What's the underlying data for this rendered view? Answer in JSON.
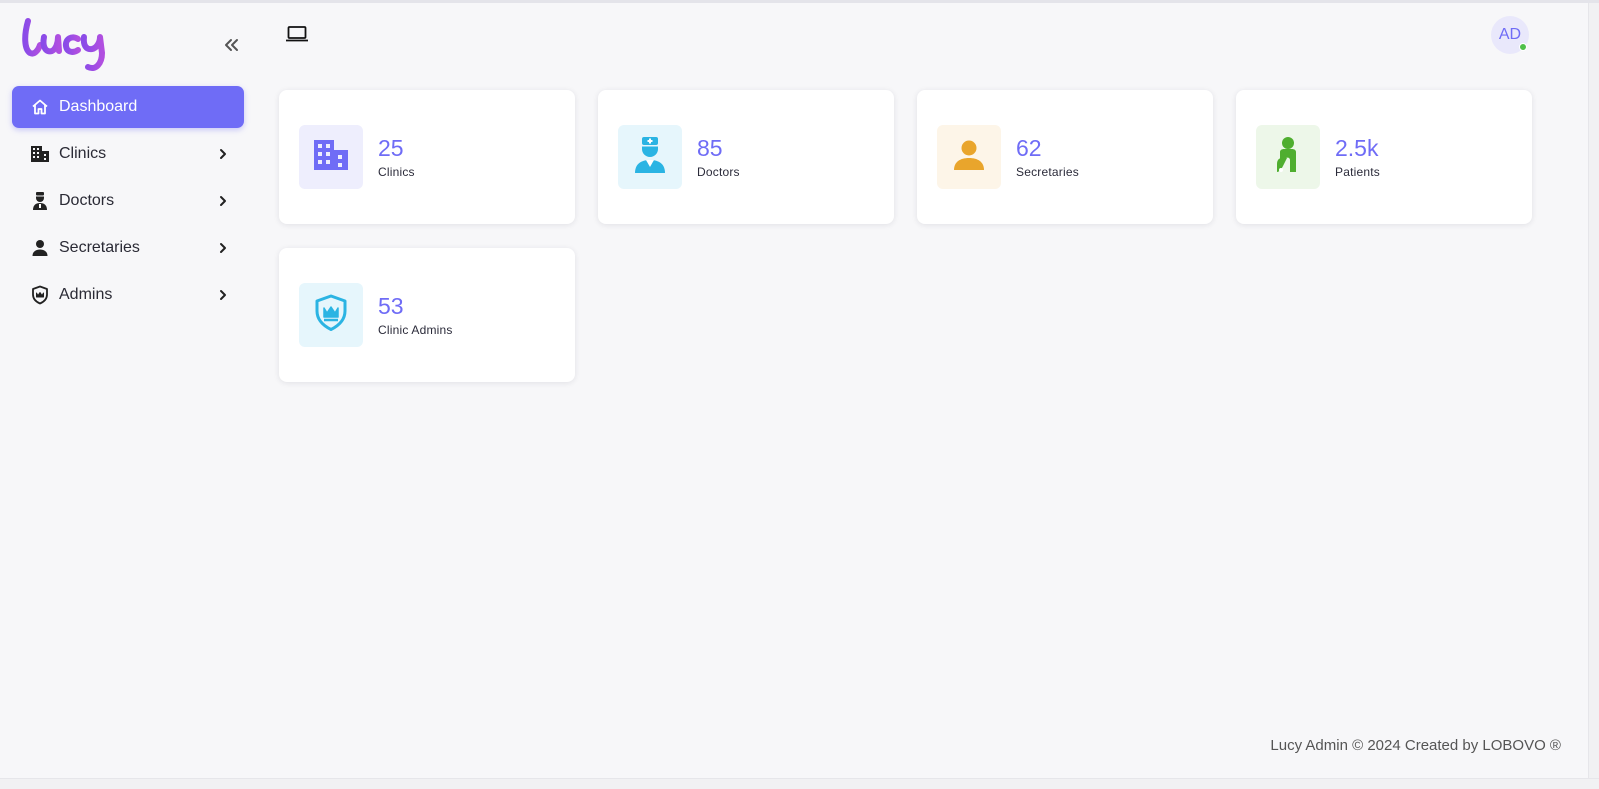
{
  "app": {
    "logo_text": "Lucy"
  },
  "sidebar": {
    "items": [
      {
        "label": "Dashboard",
        "icon": "home-icon"
      },
      {
        "label": "Clinics",
        "icon": "building-icon"
      },
      {
        "label": "Doctors",
        "icon": "doctor-icon"
      },
      {
        "label": "Secretaries",
        "icon": "person-icon"
      },
      {
        "label": "Admins",
        "icon": "shield-crown-icon"
      }
    ]
  },
  "header": {
    "avatar_initials": "AD"
  },
  "stats": [
    {
      "value": "25",
      "label": "Clinics",
      "icon": "building-icon",
      "color": "#6f6cf6",
      "tile_bg": "#eeeefd"
    },
    {
      "value": "85",
      "label": "Doctors",
      "icon": "doctor-icon",
      "color": "#2bb4e3",
      "tile_bg": "#e6f6fc"
    },
    {
      "value": "62",
      "label": "Secretaries",
      "icon": "person-icon",
      "color": "#e9a52c",
      "tile_bg": "#fdf5e8"
    },
    {
      "value": "2.5k",
      "label": "Patients",
      "icon": "patient-icon",
      "color": "#4fae2f",
      "tile_bg": "#edf7e9"
    },
    {
      "value": "53",
      "label": "Clinic Admins",
      "icon": "shield-crown-icon",
      "color": "#2bb4e3",
      "tile_bg": "#e6f6fc"
    }
  ],
  "footer": {
    "text": "Lucy Admin © 2024 Created by LOBOVO ®"
  },
  "colors": {
    "accent": "#6f6cf6",
    "background": "#f7f7f9",
    "online": "#4fc04a"
  }
}
